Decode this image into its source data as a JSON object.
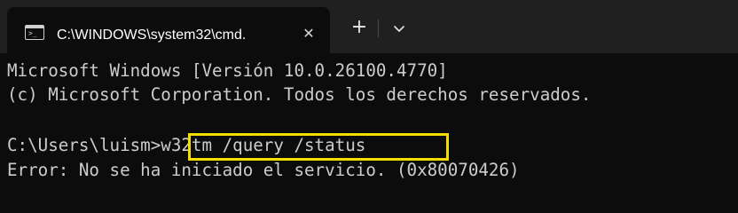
{
  "tab": {
    "title": "C:\\WINDOWS\\system32\\cmd.",
    "icon": "terminal-icon",
    "close_icon": "close-icon",
    "prompt_glyph": ">_"
  },
  "tabbar": {
    "new_tab_icon": "plus-icon",
    "new_tab_glyph": "+",
    "dropdown_icon": "chevron-down-icon",
    "close_glyph": "✕"
  },
  "terminal": {
    "lines": [
      "Microsoft Windows [Versión 10.0.26100.4770]",
      "(c) Microsoft Corporation. Todos los derechos reservados.",
      "",
      "C:\\Users\\luism>w32tm /query /status",
      "Error: No se ha iniciado el servicio. (0x80070426)"
    ],
    "prompt": "C:\\Users\\luism>",
    "command": "w32tm /query /status"
  },
  "colors": {
    "background": "#0c0c0c",
    "tabbar": "#202020",
    "text": "#cccccc",
    "highlight": "#f5dd00"
  }
}
